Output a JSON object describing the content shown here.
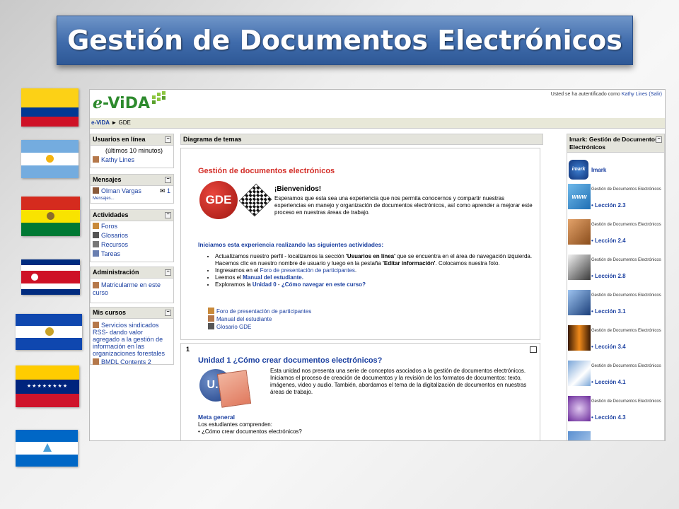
{
  "slide_title": "Gestión de Documentos Electrónicos",
  "app": {
    "logo_text_e": "e",
    "logo_text_main": "-ViDA",
    "login_prefix": "Usted se ha autentificado como",
    "login_user": "Kathy Lines",
    "login_exit": "(Salir)",
    "breadcrumb": {
      "home": "e-ViDA",
      "sep": "►",
      "current": "GDE"
    }
  },
  "left_blocks": {
    "online": {
      "title": "Usuarios en línea",
      "subtitle": "(últimos 10 minutos)",
      "user": "Kathy Lines"
    },
    "messages": {
      "title": "Mensajes",
      "user": "Olman Vargas",
      "count": "1",
      "link": "Mensajes..."
    },
    "activities": {
      "title": "Actividades",
      "items": [
        "Foros",
        "Glosarios",
        "Recursos",
        "Tareas"
      ]
    },
    "admin": {
      "title": "Administración",
      "item": "Matricularme en este curso"
    },
    "courses": {
      "title": "Mis cursos",
      "item1": "Servicios sindicados RSS- dando valor agregado a la gestión de información en las organizaciones forestales",
      "item2": "BMDL Contents 2"
    }
  },
  "center": {
    "header": "Diagrama de temas",
    "sec0": {
      "title": "Gestión de documentos electrónicos",
      "logo_text": "GDE",
      "welcome": "¡Bienvenidos!",
      "intro": "Esperamos que esta sea una experiencia que nos permita conocernos y compartir nuestras experiencias en manejo y organización de documentos electrónicos, así como aprender a mejorar este proceso en nuestras áreas de trabajo.",
      "start_heading": "Iniciamos esta experiencia realizando las siguientes actividades:",
      "act1_a": "Actualizamos nuestro perfil - localizamos la sección ",
      "act1_b": "'Usuarios en línea'",
      "act1_c": " que se encuentra en el área de navegación izquierda. Hacemos clic en nuestro nombre de usuario y luego en la pestaña ",
      "act1_d": "'Editar información'",
      "act1_e": ". Colocamos nuestra foto.",
      "act2_a": "Ingresamos en el ",
      "act2_b": "Foro de presentación de participantes",
      "act2_c": ".",
      "act3_a": "Leemos el ",
      "act3_b": "Manual del estudiante.",
      "act4_a": "Exploramos la ",
      "act4_b": "Unidad 0",
      "act4_c": " - ",
      "act4_d": "¿Cómo navegar en este curso?",
      "res1": "Foro de presentación de participantes",
      "res2": "Manual del estudiante",
      "res3": "Glosario GDE"
    },
    "sec1": {
      "number": "1",
      "title": "Unidad 1 ¿Cómo crear documentos electrónicos?",
      "logo_text": "U.1",
      "desc": "Esta unidad nos presenta una serie de conceptos asociados a la gestión de documentos electrónicos. Iniciamos el proceso de creación de documentos y la revisión de los formatos de documentos: texto, imágenes, video y audio. También, abordamos el tema de la digitalización de documentos en nuestras áreas de trabajo.",
      "meta_title": "Meta general",
      "meta_text": "Los estudiantes comprenden:",
      "meta_item": "• ¿Cómo crear documentos electrónicos?"
    }
  },
  "right": {
    "title": "Imark: Gestión de Documentos Electrónicos",
    "imark_label": "Imark",
    "imark_logo": "imark",
    "lesson_prefix": "Gestión de Documentos Electrónicos",
    "lessons": [
      "• Lección 2.3",
      "• Lección 2.4",
      "• Lección 2.8",
      "• Lección 3.1",
      "• Lección 3.4",
      "• Lección 4.1",
      "• Lección 4.3"
    ],
    "thumb_www": "www"
  },
  "colors": {
    "link": "#1a3fa0",
    "banner": "#3f6bab",
    "red_title": "#d32d27"
  }
}
